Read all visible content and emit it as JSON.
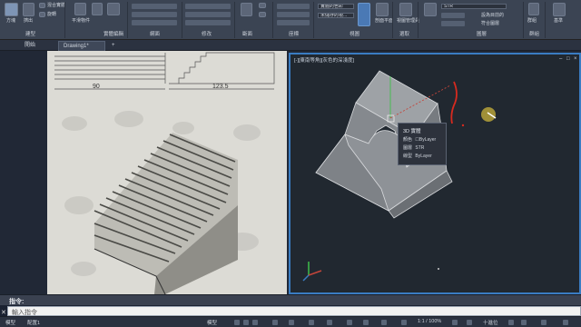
{
  "ribbon": {
    "groups": [
      {
        "title": "建型",
        "buttons": [
          "方塊",
          "擠出",
          "混合實體",
          "旋轉"
        ]
      },
      {
        "title": "實體編輯",
        "buttons": [
          "平滑物件"
        ]
      },
      {
        "title": "網面",
        "buttons": []
      },
      {
        "title": "修改",
        "buttons": []
      },
      {
        "title": "斷面",
        "buttons": []
      },
      {
        "title": "座標",
        "buttons": []
      },
      {
        "title": "視圖",
        "buttons": []
      },
      {
        "title": "選取",
        "buttons": []
      },
      {
        "title": "圖層",
        "buttons": []
      },
      {
        "title": "群組",
        "buttons": []
      }
    ],
    "visual_style_select": "實體的色彩",
    "unsaved_state_select": "未儲存的視...",
    "layer_select": "STR",
    "view_buttons": [
      "移動",
      "剖面平面",
      "視圖管理員"
    ],
    "layer_buttons": [
      "設為目前的",
      "符合圖層"
    ],
    "right_labels": [
      "群組",
      "基準"
    ]
  },
  "tabs": [
    {
      "label": "開始",
      "active": false
    },
    {
      "label": "Drawing1*",
      "active": true
    }
  ],
  "reference_image": {
    "dim_left": "90",
    "dim_right": "123.5"
  },
  "viewport": {
    "title": "[-][東南等角][灰色的深淺度]",
    "controls": [
      "–",
      "□",
      "×"
    ]
  },
  "tooltip": {
    "title": "3D 實體",
    "rows": [
      {
        "key": "顏色",
        "value": "☐ByLayer"
      },
      {
        "key": "圖層",
        "value": "STR"
      },
      {
        "key": "線型",
        "value": "ByLayer"
      }
    ]
  },
  "command": {
    "title": "指令:",
    "placeholder": "輸入指令"
  },
  "status": {
    "layout_tabs": [
      "模型",
      "配置1"
    ],
    "model_label": "模型",
    "scale": "1:1 / 100%",
    "decimal": "十進位"
  },
  "colors": {
    "accent": "#3a7cc2",
    "workspace_bg": "#212830",
    "red_stroke": "#d62a1f"
  }
}
